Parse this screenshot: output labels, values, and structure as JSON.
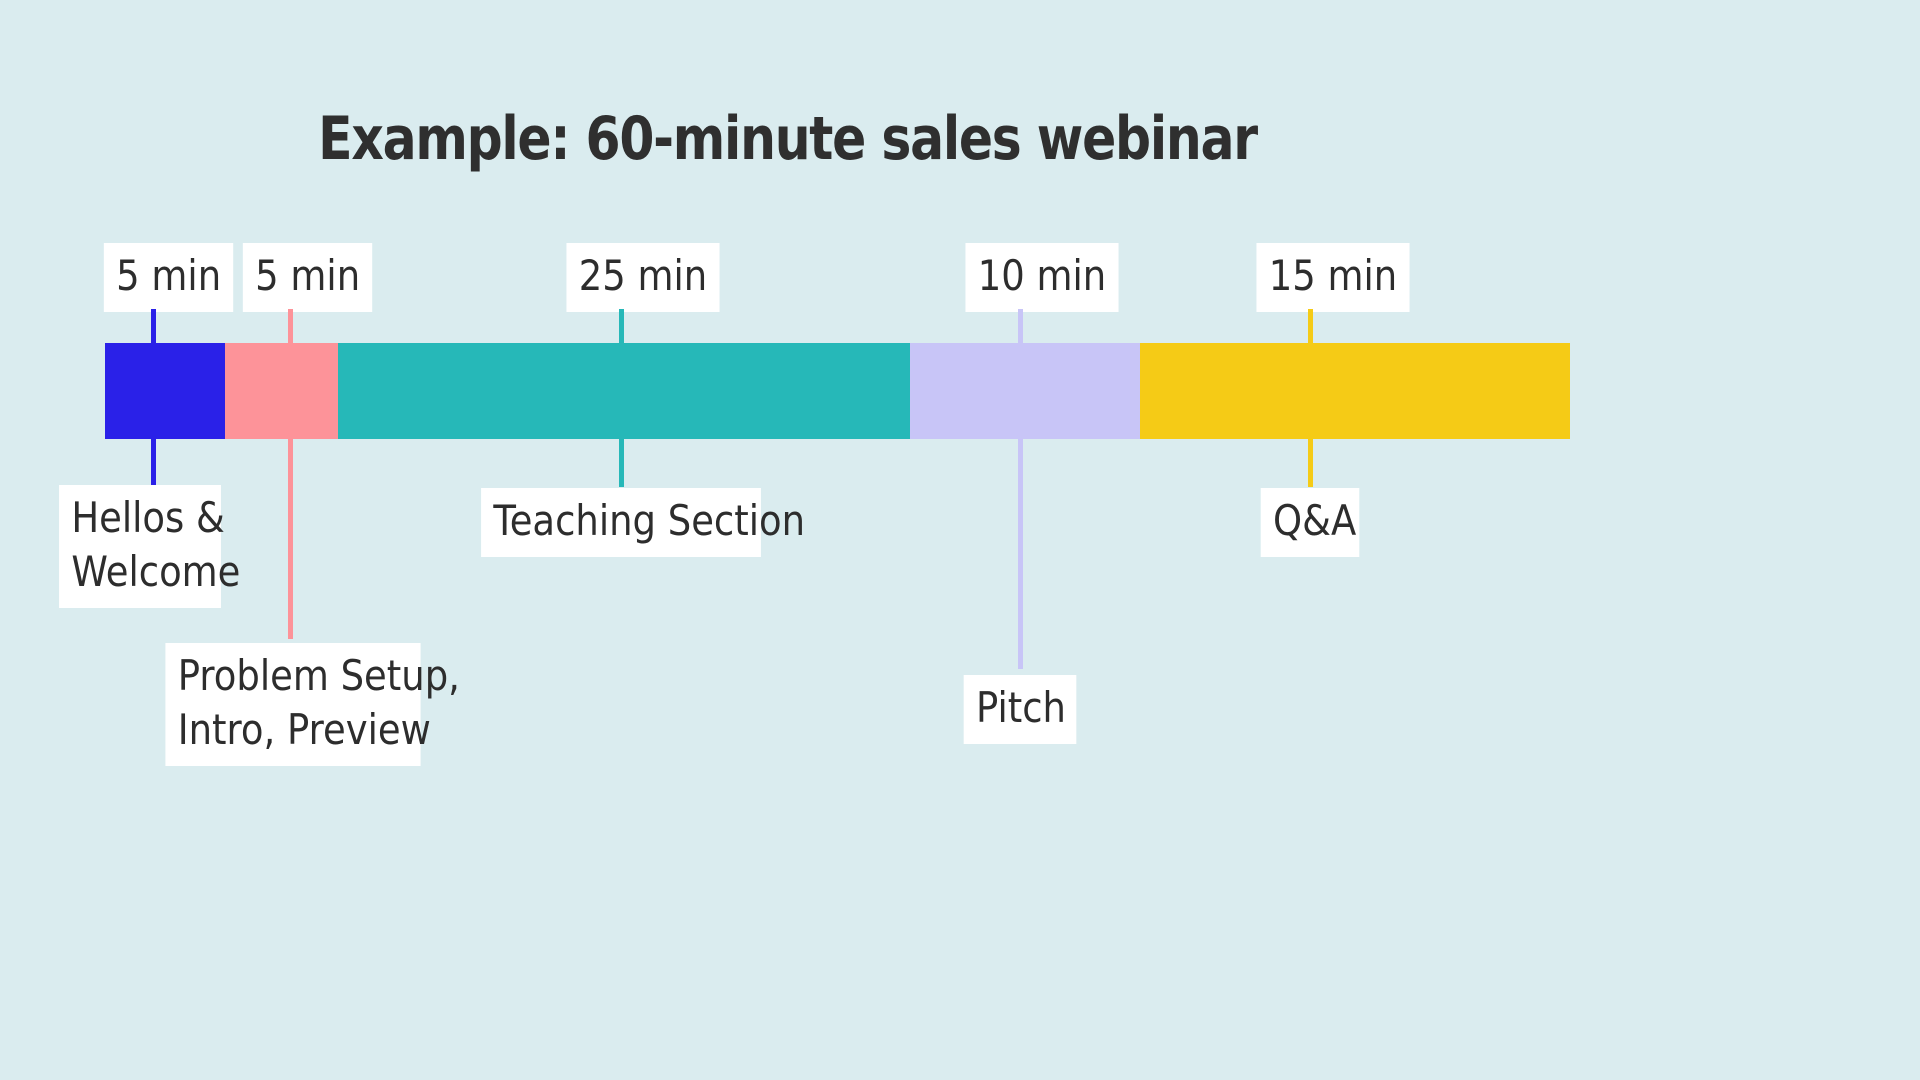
{
  "background_color": "#daecef",
  "title": "Example: 60-minute sales webinar",
  "title_color": "#2f2f2f",
  "label_box": {
    "background": "#ffffff",
    "text_color": "#2d2d2d"
  },
  "chart_data": {
    "type": "bar",
    "orientation": "horizontal-stacked",
    "title": "Example: 60-minute sales webinar",
    "xlabel": "",
    "ylabel": "",
    "total_minutes": 60,
    "unit": "min",
    "categories": [
      "Hellos & Welcome",
      "Problem Setup, Intro, Preview",
      "Teaching Section",
      "Pitch",
      "Q&A"
    ],
    "values": [
      5,
      5,
      25,
      10,
      15
    ],
    "value_labels": [
      "5 min",
      "5 min",
      "25 min",
      "10 min",
      "15 min"
    ],
    "colors": [
      "#2a21e8",
      "#fd9399",
      "#26b8b8",
      "#c8c5f7",
      "#f5cb16"
    ],
    "segments": [
      {
        "name": "Hellos & Welcome",
        "name_lines": [
          "Hellos &",
          "Welcome"
        ],
        "duration": "5 min",
        "minutes": 5,
        "color": "#2a21e8",
        "label_position": "below"
      },
      {
        "name": "Problem Setup, Intro, Preview",
        "name_lines": [
          "Problem Setup,",
          "Intro, Preview"
        ],
        "duration": "5 min",
        "minutes": 5,
        "color": "#fd9399",
        "label_position": "below"
      },
      {
        "name": "Teaching Section",
        "name_lines": [
          "Teaching Section"
        ],
        "duration": "25 min",
        "minutes": 25,
        "color": "#26b8b8",
        "label_position": "below"
      },
      {
        "name": "Pitch",
        "name_lines": [
          "Pitch"
        ],
        "duration": "10 min",
        "minutes": 10,
        "color": "#c8c5f7",
        "label_position": "below"
      },
      {
        "name": "Q&A",
        "name_lines": [
          "Q&A"
        ],
        "duration": "15 min",
        "minutes": 15,
        "color": "#f5cb16",
        "label_position": "below"
      }
    ]
  }
}
